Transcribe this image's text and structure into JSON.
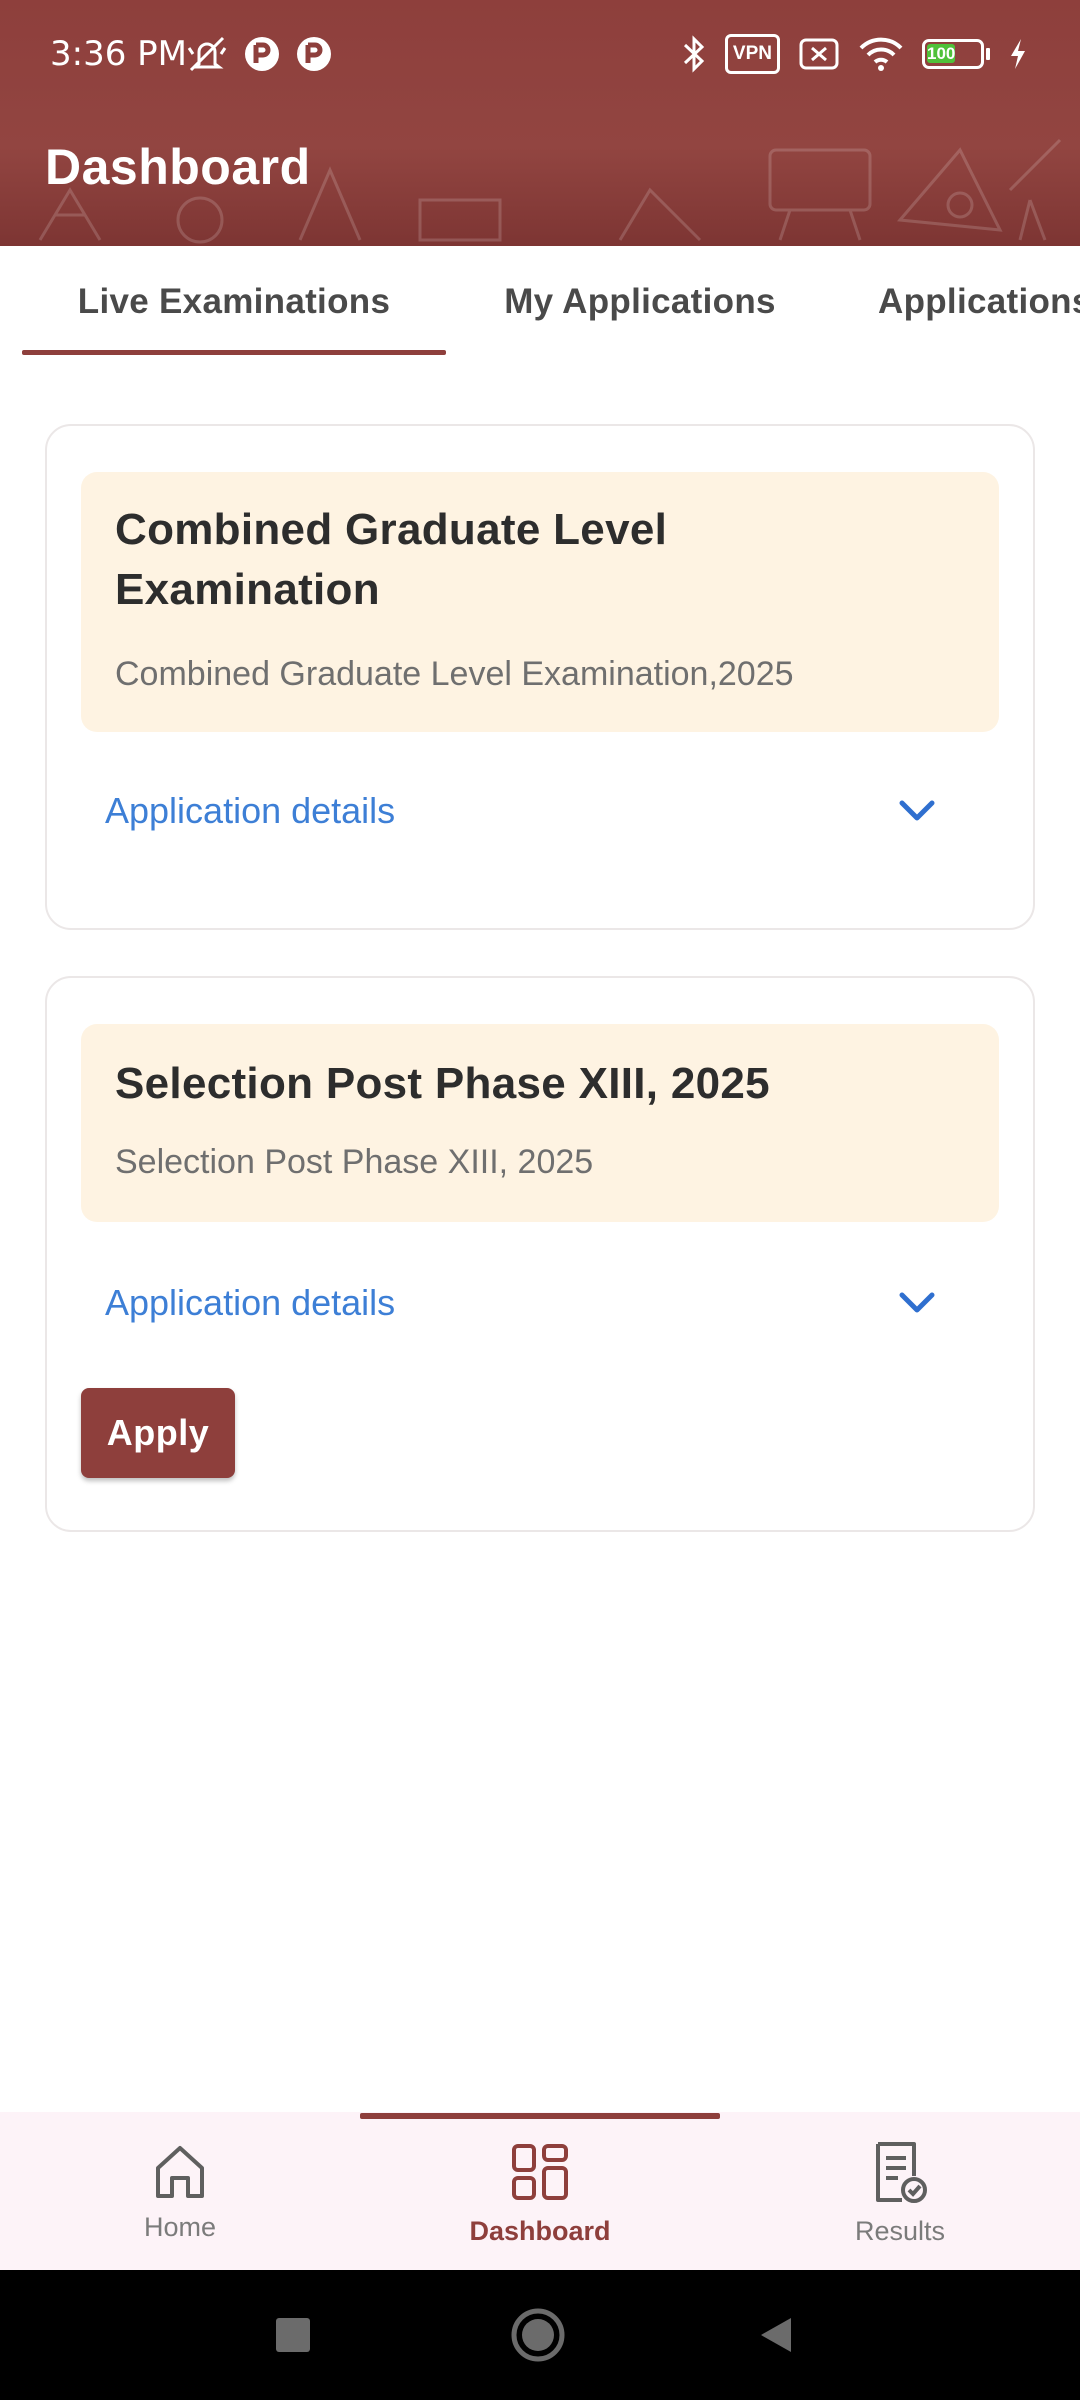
{
  "status_bar": {
    "time": "3:36 PM",
    "vpn_label": "VPN",
    "battery_level": "100",
    "icons_left": [
      "mute-icon",
      "app-notification-icon",
      "app-notification-icon"
    ],
    "icons_right": [
      "bluetooth-icon",
      "vpn-icon",
      "sim-error-icon",
      "wifi-icon",
      "battery-icon",
      "charging-icon"
    ]
  },
  "header": {
    "title": "Dashboard",
    "background_color": "#8e3f3c"
  },
  "tabs": [
    {
      "label": "Live Examinations",
      "active": true
    },
    {
      "label": "My Applications",
      "active": false
    },
    {
      "label": "Applications",
      "active": false
    }
  ],
  "cards": [
    {
      "title_line1": "Combined Graduate Level",
      "title_line2": "Examination",
      "subtitle": "Combined Graduate Level Examination,2025",
      "details_label": "Application details",
      "has_apply": false
    },
    {
      "title_line1": "Selection Post Phase XIII, 2025",
      "subtitle": "Selection Post Phase XIII, 2025",
      "details_label": "Application details",
      "has_apply": true,
      "apply_label": "Apply"
    }
  ],
  "bottom_nav": [
    {
      "label": "Home",
      "icon": "home-icon",
      "active": false
    },
    {
      "label": "Dashboard",
      "icon": "dashboard-grid-icon",
      "active": true
    },
    {
      "label": "Results",
      "icon": "results-document-icon",
      "active": false
    }
  ],
  "colors": {
    "accent": "#8e3f3c",
    "card_header_bg": "#fef3e2",
    "link": "#3d7fd6",
    "nav_bg": "#fdf3f8"
  }
}
